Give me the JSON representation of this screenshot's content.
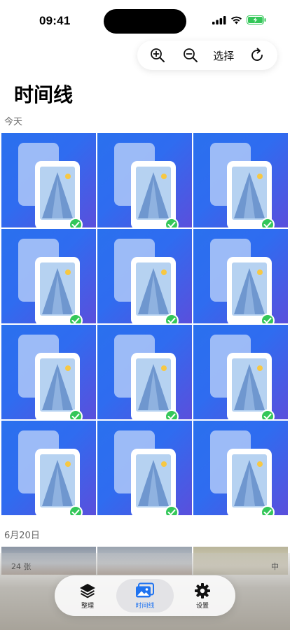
{
  "status_bar": {
    "time": "09:41"
  },
  "toolbar": {
    "zoom_in_icon": "zoom-in-icon",
    "zoom_out_icon": "zoom-out-icon",
    "select_label": "选择",
    "refresh_icon": "refresh-icon"
  },
  "page": {
    "title": "时间线"
  },
  "sections": [
    {
      "label": "今天",
      "photo_count": 12
    },
    {
      "label": "6月20日"
    }
  ],
  "footer": {
    "count": "24 张",
    "size": "中"
  },
  "tab_bar": {
    "tabs": [
      {
        "label": "整理",
        "icon": "layers-icon",
        "active": false
      },
      {
        "label": "时间线",
        "icon": "photos-icon",
        "active": true
      },
      {
        "label": "设置",
        "icon": "gear-icon",
        "active": false
      }
    ]
  },
  "colors": {
    "accent": "#1f73f0",
    "check": "#34c759",
    "tile_blue": "#2f6cf0"
  }
}
